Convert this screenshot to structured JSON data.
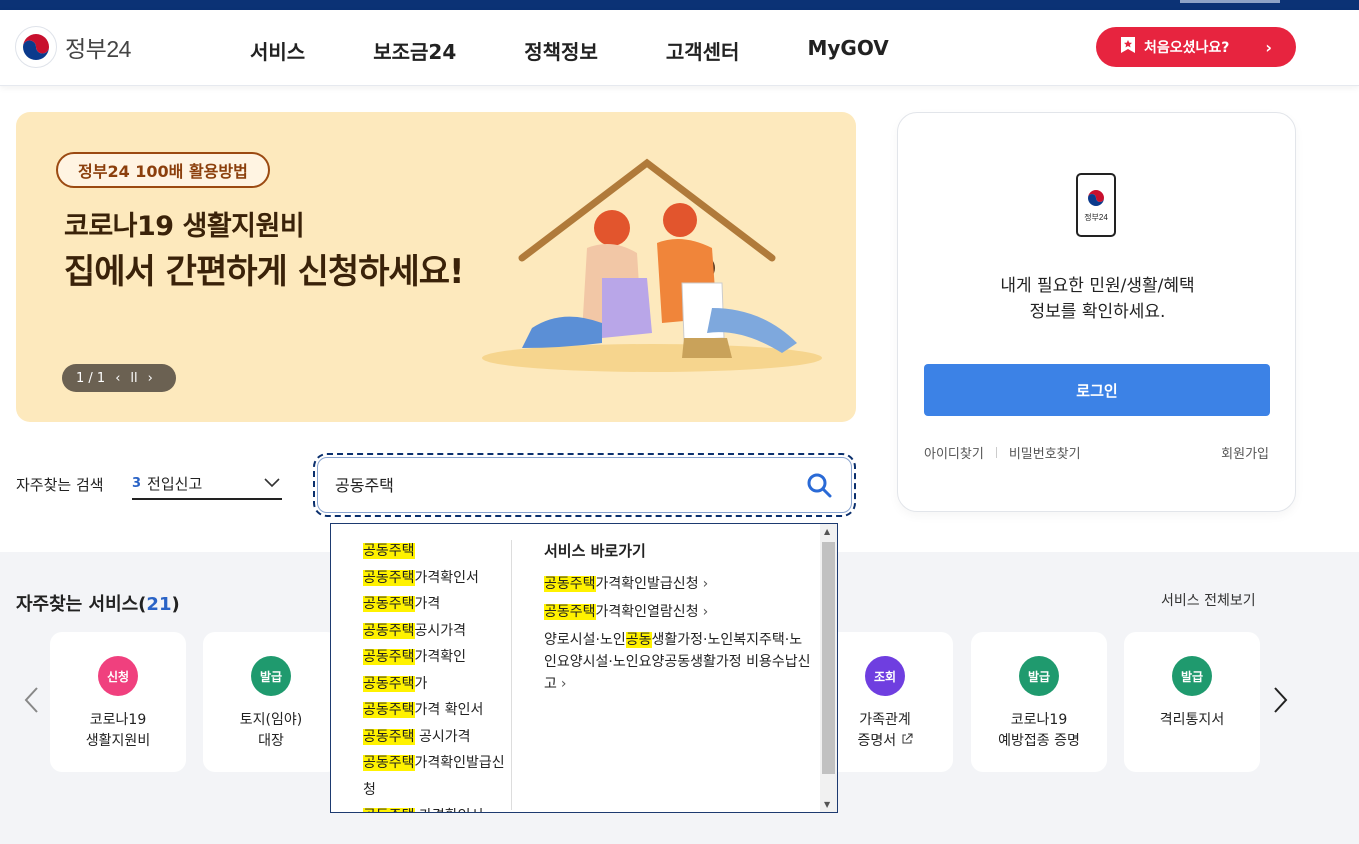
{
  "header": {
    "logo_text": "정부24",
    "nav": [
      "서비스",
      "보조금24",
      "정책정보",
      "고객센터",
      "MyGOV"
    ],
    "cta_label": "처음오셨나요?"
  },
  "banner": {
    "badge": "정부24 100배 활용방법",
    "subtitle": "코로나19 생활지원비",
    "title": "집에서 간편하게 신청하세요!",
    "pager": "1 / 1"
  },
  "login": {
    "phone_label": "정부24",
    "message_line1": "내게 필요한 민원/생활/혜택",
    "message_line2": "정보를 확인하세요.",
    "button": "로그인",
    "find_id": "아이디찾기",
    "find_pw": "비밀번호찾기",
    "signup": "회원가입"
  },
  "frequent_search": {
    "label": "자주찾는 검색",
    "rank": "3",
    "selected": "전입신고"
  },
  "search": {
    "value": "공동주택",
    "placeholder": ""
  },
  "autocomplete": {
    "suggestions": [
      {
        "hl": "공동주택",
        "rest": ""
      },
      {
        "hl": "공동주택",
        "rest": "가격확인서"
      },
      {
        "hl": "공동주택",
        "rest": "가격"
      },
      {
        "hl": "공동주택",
        "rest": "공시가격"
      },
      {
        "hl": "공동주택",
        "rest": "가격확인"
      },
      {
        "hl": "공동주택",
        "rest": "가"
      },
      {
        "hl": "공동주택",
        "rest": "가격 확인서"
      },
      {
        "hl": "공동주택",
        "rest": " 공시가격"
      },
      {
        "hl": "공동주택",
        "rest": "가격확인발급신청"
      },
      {
        "hl": "공동주택",
        "rest": " 가격확인서"
      }
    ],
    "shortcuts_heading": "서비스 바로가기",
    "shortcuts": [
      {
        "pre": "",
        "hl": "공동주택",
        "post": "가격확인발급신청"
      },
      {
        "pre": "",
        "hl": "공동주택",
        "post": "가격확인열람신청"
      },
      {
        "pre": "양로시설·노인",
        "hl": "공동",
        "post": "생활가정·노인복지주택·노인요양시설·노인요양공동생활가정 비용수납신고"
      }
    ]
  },
  "services": {
    "title": "자주찾는 서비스(",
    "count": "21",
    "title_end": ")",
    "view_all": "서비스 전체보기",
    "cards": [
      {
        "badge": "신청",
        "color": "#f0407e",
        "name": "코로나19\n생활지원비"
      },
      {
        "badge": "발급",
        "color": "#1f9a6e",
        "name": "토지(임야)\n대장"
      },
      {
        "badge": "조회",
        "color": "#6f3ee0",
        "name": "가족관계\n증명서"
      },
      {
        "badge": "발급",
        "color": "#1f9a6e",
        "name": "코로나19\n예방접종 증명"
      },
      {
        "badge": "발급",
        "color": "#1f9a6e",
        "name": "격리통지서"
      }
    ]
  }
}
